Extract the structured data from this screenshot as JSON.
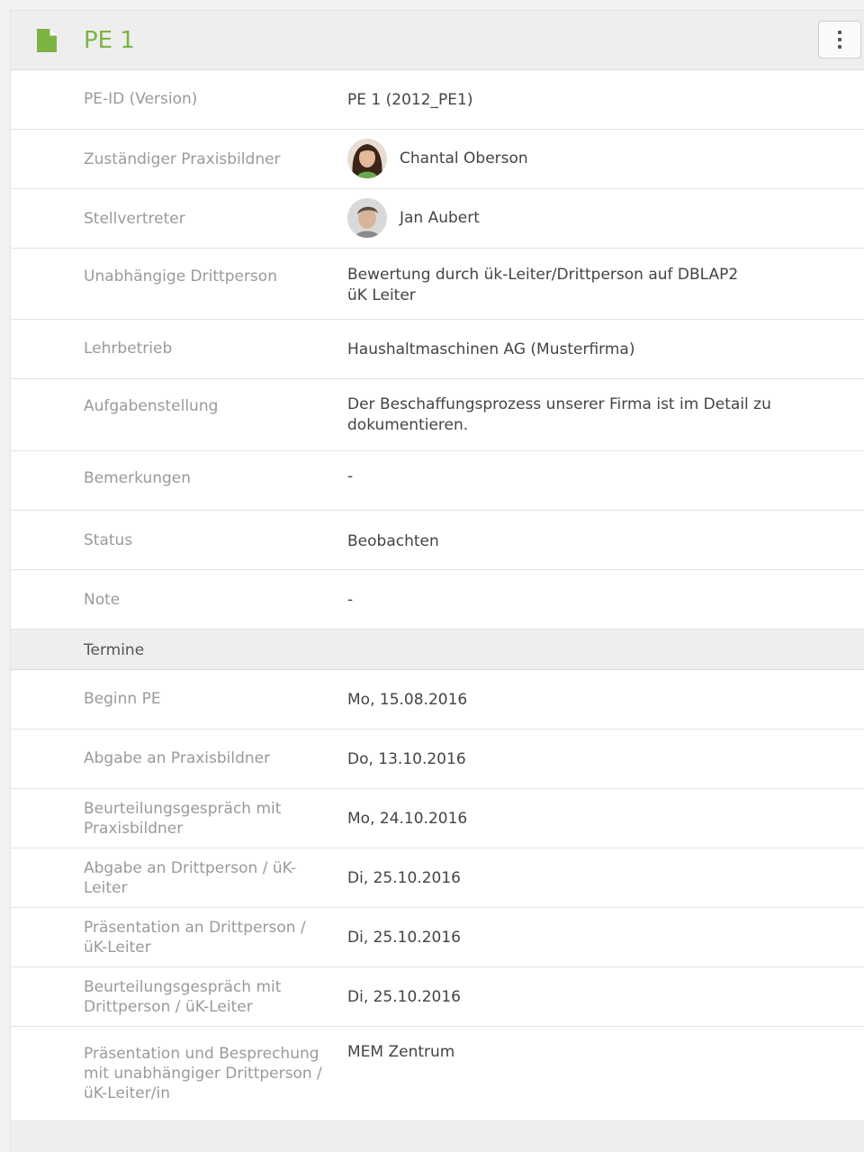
{
  "header": {
    "title": "PE 1",
    "icon": "document-icon",
    "menu_icon": "vertical-dots-icon",
    "accent_color": "#7cb342"
  },
  "details": {
    "pe_id": {
      "label": "PE-ID (Version)",
      "value": "PE 1 (2012_PE1)"
    },
    "praxisbildner": {
      "label": "Zuständiger Praxisbildner",
      "value": "Chantal Oberson"
    },
    "stellvertreter": {
      "label": "Stellvertreter",
      "value": "Jan Aubert"
    },
    "drittperson": {
      "label": "Unabhängige Drittperson",
      "value_line1": "Bewertung durch ük-Leiter/Drittperson auf DBLAP2",
      "value_line2": "üK Leiter"
    },
    "lehrbetrieb": {
      "label": "Lehrbetrieb",
      "value": "Haushaltmaschinen AG (Musterfirma)"
    },
    "aufgabenstellung": {
      "label": "Aufgabenstellung",
      "value": "Der Beschaffungsprozess unserer Firma ist im Detail zu dokumentieren."
    },
    "bemerkungen": {
      "label": "Bemerkungen",
      "value": "-"
    },
    "status": {
      "label": "Status",
      "value": "Beobachten"
    },
    "note": {
      "label": "Note",
      "value": "-"
    }
  },
  "termine": {
    "section_label": "Termine",
    "beginn": {
      "label": "Beginn PE",
      "value": "Mo, 15.08.2016"
    },
    "abgabe_praxisbildner": {
      "label": "Abgabe an Praxisbildner",
      "value": "Do, 13.10.2016"
    },
    "beurteilung_praxisbildner": {
      "label": "Beurteilungsgespräch mit Praxisbildner",
      "value": "Mo, 24.10.2016"
    },
    "abgabe_drittperson": {
      "label": "Abgabe an Drittperson / üK-Leiter",
      "value": "Di, 25.10.2016"
    },
    "praesentation_drittperson": {
      "label": "Präsentation an Drittperson / üK-Leiter",
      "value": "Di, 25.10.2016"
    },
    "beurteilung_drittperson": {
      "label": "Beurteilungsgespräch mit Drittperson / üK-Leiter",
      "value": "Di, 25.10.2016"
    },
    "praesentation_besprechung": {
      "label": "Präsentation und Besprechung mit unabhängiger Drittperson / üK-Leiter/in",
      "value": "MEM Zentrum"
    }
  }
}
